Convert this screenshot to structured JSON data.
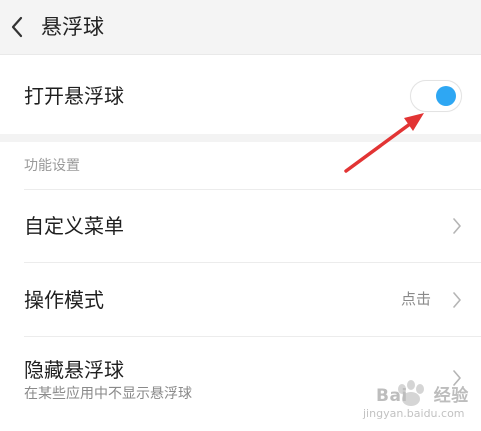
{
  "header": {
    "title": "悬浮球",
    "back_icon": "chevron-left-icon"
  },
  "toggle_row": {
    "label": "打开悬浮球",
    "enabled": true,
    "knob_color": "#2ea7f3"
  },
  "section": {
    "title": "功能设置"
  },
  "items": [
    {
      "label": "自定义菜单",
      "value": "",
      "sub": ""
    },
    {
      "label": "操作模式",
      "value": "点击",
      "sub": ""
    },
    {
      "label": "隐藏悬浮球",
      "value": "",
      "sub": "在某些应用中不显示悬浮球"
    }
  ],
  "annotation": {
    "arrow_color": "#e23434"
  },
  "watermark": {
    "logo_text": "Bai",
    "brand_text": "经验",
    "url": "jingyan.baidu.com"
  }
}
